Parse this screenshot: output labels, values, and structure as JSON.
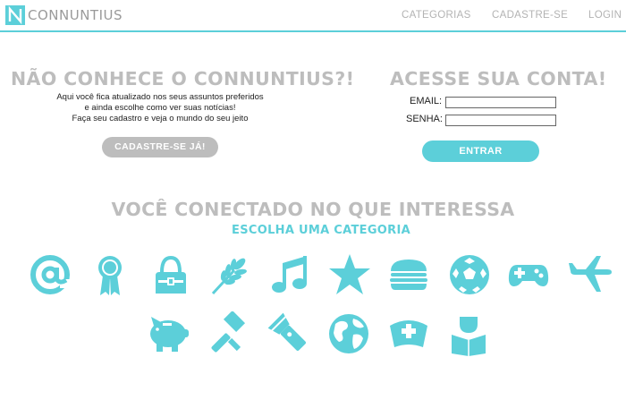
{
  "brand": {
    "name": "CONNUNTIUS",
    "accent_color": "#5ccfd9",
    "gray_color": "#bdbdbd"
  },
  "nav": {
    "categories": "CATEGORIAS",
    "register": "CADASTRE-SE",
    "login": "LOGIN"
  },
  "promo": {
    "title": "NÃO CONHECE O CONNUNTIUS?!",
    "lines": [
      "Aqui você fica atualizado nos seus assuntos preferidos",
      "e ainda escolhe como ver suas notícias!",
      "Faça seu cadastro e veja o mundo do seu jeito"
    ],
    "button": "CADASTRE-SE JÁ!"
  },
  "login": {
    "title": "ACESSE SUA CONTA!",
    "email_label": "EMAIL:",
    "password_label": "SENHA:",
    "email_value": "",
    "password_value": "",
    "button": "ENTRAR"
  },
  "section": {
    "title": "VOCÊ CONECTADO NO QUE INTERESSA",
    "subtitle": "ESCOLHA UMA CATEGORIA"
  },
  "categories": [
    {
      "icon": "at-sign-icon"
    },
    {
      "icon": "award-ribbon-icon"
    },
    {
      "icon": "handbag-icon"
    },
    {
      "icon": "wheat-icon"
    },
    {
      "icon": "music-note-icon"
    },
    {
      "icon": "star-icon"
    },
    {
      "icon": "burger-icon"
    },
    {
      "icon": "soccer-ball-icon"
    },
    {
      "icon": "gamepad-icon"
    },
    {
      "icon": "airplane-icon"
    },
    {
      "icon": "piggy-bank-icon"
    },
    {
      "icon": "hammer-icon"
    },
    {
      "icon": "flashlight-icon"
    },
    {
      "icon": "globe-icon"
    },
    {
      "icon": "nurse-cap-icon"
    },
    {
      "icon": "reader-icon"
    }
  ]
}
